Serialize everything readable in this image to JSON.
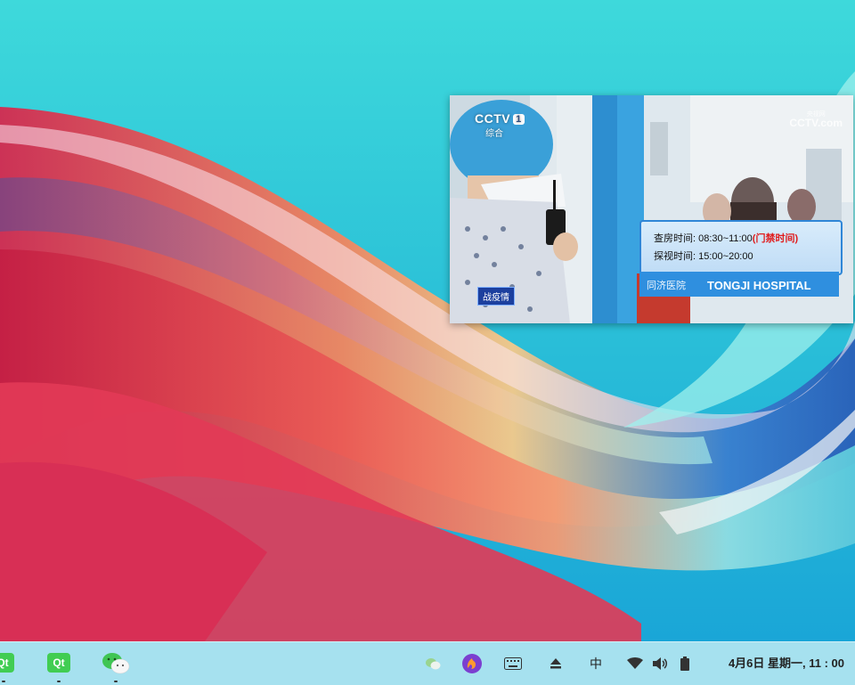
{
  "desktop": {
    "gradient_colors": [
      "#3ed9db",
      "#1aa6d7"
    ]
  },
  "video": {
    "channel_logo": "CCTV",
    "channel_number": "1",
    "channel_sub": "综合",
    "watermark": "CCTV.com",
    "watermark_sub": "央视网",
    "news_tag": "战疫情",
    "sign": {
      "ward_round_label": "查房时间:",
      "ward_round_time": "08:30~11:00",
      "closed_note": "(门禁时间)",
      "visit_label": "探视时间:",
      "visit_time": "15:00~20:00"
    },
    "hospital_cn": "同济医院",
    "hospital_en": "TONGJI HOSPITAL"
  },
  "taskbar": {
    "apps": [
      {
        "name": "qt-creator-1",
        "label": "Qt"
      },
      {
        "name": "qt-creator-2",
        "label": "Qt"
      },
      {
        "name": "wechat",
        "label": ""
      }
    ],
    "tray": {
      "input_method": "中"
    },
    "clock": "4月6日 星期一, 11 : 00"
  }
}
